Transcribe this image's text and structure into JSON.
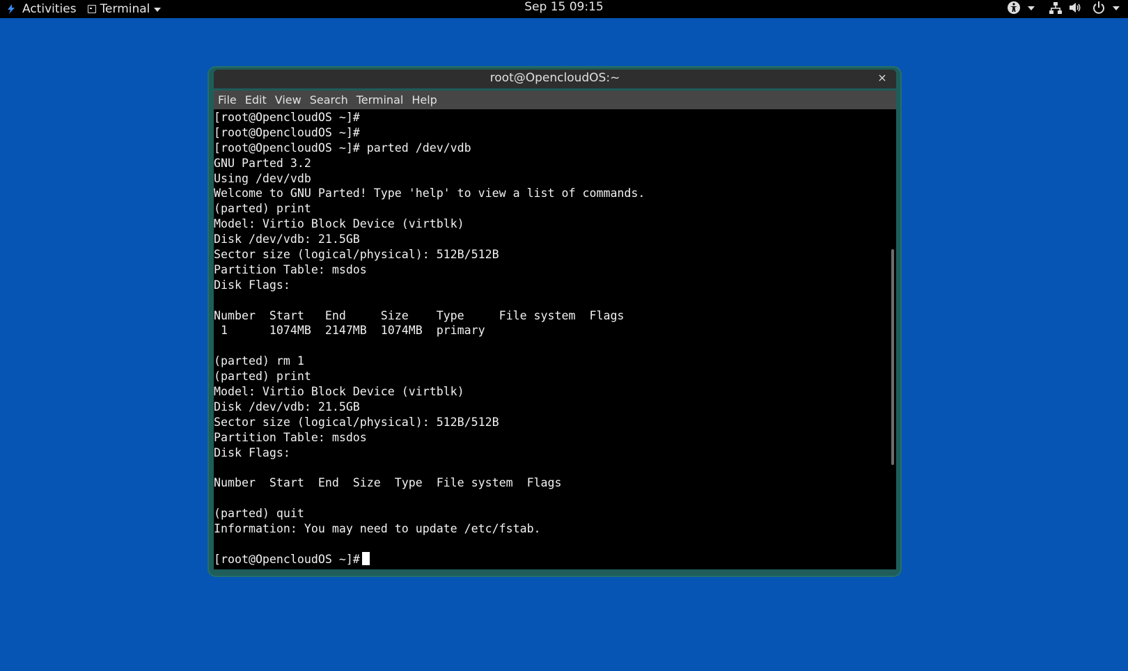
{
  "topbar": {
    "activities": "Activities",
    "app_menu": "Terminal",
    "clock": "Sep 15  09:15",
    "status_icons": [
      "accessibility-icon",
      "network-icon",
      "volume-icon",
      "power-icon"
    ]
  },
  "window": {
    "title": "root@OpencloudOS:~",
    "close_glyph": "×",
    "menu": [
      "File",
      "Edit",
      "View",
      "Search",
      "Terminal",
      "Help"
    ]
  },
  "terminal": {
    "lines": [
      "[root@OpencloudOS ~]#",
      "[root@OpencloudOS ~]#",
      "[root@OpencloudOS ~]# parted /dev/vdb",
      "GNU Parted 3.2",
      "Using /dev/vdb",
      "Welcome to GNU Parted! Type 'help' to view a list of commands.",
      "(parted) print",
      "Model: Virtio Block Device (virtblk)",
      "Disk /dev/vdb: 21.5GB",
      "Sector size (logical/physical): 512B/512B",
      "Partition Table: msdos",
      "Disk Flags:",
      "",
      "Number  Start   End     Size    Type     File system  Flags",
      " 1      1074MB  2147MB  1074MB  primary",
      "",
      "(parted) rm 1",
      "(parted) print",
      "Model: Virtio Block Device (virtblk)",
      "Disk /dev/vdb: 21.5GB",
      "Sector size (logical/physical): 512B/512B",
      "Partition Table: msdos",
      "Disk Flags:",
      "",
      "Number  Start  End  Size  Type  File system  Flags",
      "",
      "(parted) quit",
      "Information: You may need to update /etc/fstab.",
      ""
    ],
    "prompt": "[root@OpencloudOS ~]#",
    "scroll_position": 0.58
  },
  "colors": {
    "desktop": "#0654b3",
    "topbar": "#000000",
    "titlebar": "#2e2e2e",
    "menubar": "#464646",
    "terminal_bg": "#000000",
    "terminal_fg": "#f2f2f2",
    "window_frame": "#1e5d5a"
  }
}
